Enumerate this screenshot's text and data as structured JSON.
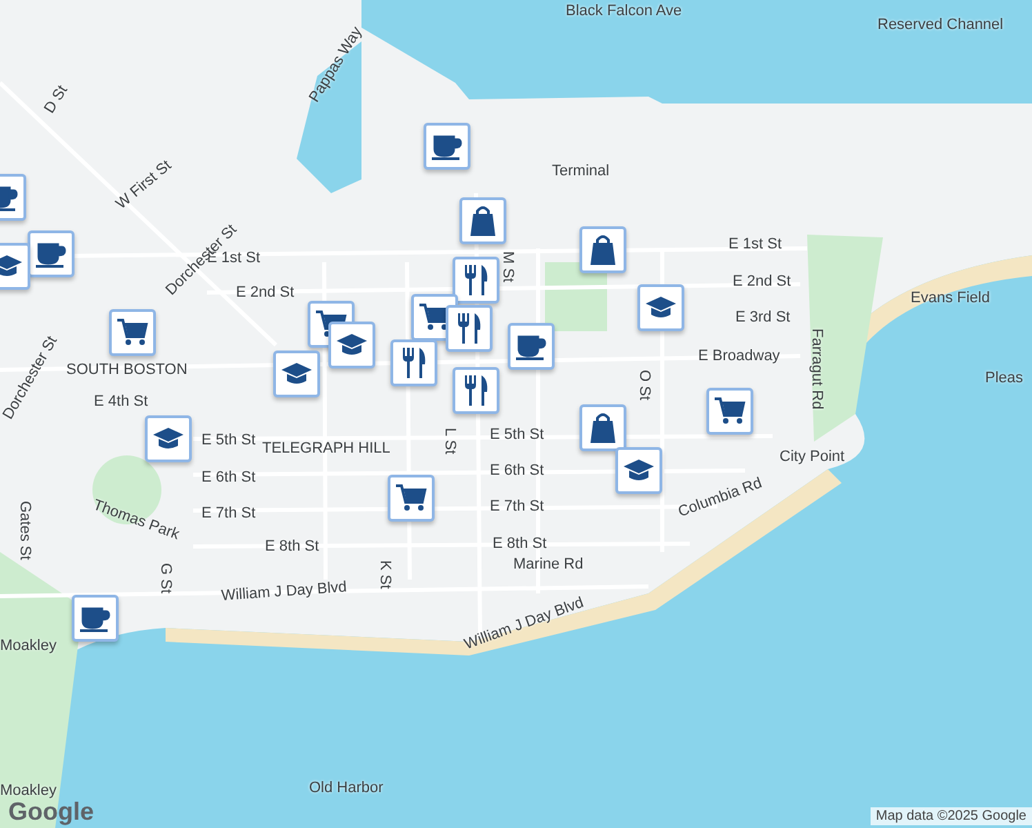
{
  "map": {
    "labels": [
      {
        "text": "Black Falcon Ave"
      },
      {
        "text": "Reserved Channel"
      },
      {
        "text": "Pappas Way"
      },
      {
        "text": "D St"
      },
      {
        "text": "W First St"
      },
      {
        "text": "E 1st St"
      },
      {
        "text": "E 1st St"
      },
      {
        "text": "E 2nd St"
      },
      {
        "text": "E 2nd St"
      },
      {
        "text": "E 3rd St"
      },
      {
        "text": "Dorchester St"
      },
      {
        "text": "SOUTH BOSTON"
      },
      {
        "text": "E Broadway"
      },
      {
        "text": "E 4th St"
      },
      {
        "text": "E 5th St"
      },
      {
        "text": "TELEGRAPH HILL"
      },
      {
        "text": "E 5th St"
      },
      {
        "text": "City Point"
      },
      {
        "text": "E 6th St"
      },
      {
        "text": "E 6th St"
      },
      {
        "text": "E 7th St"
      },
      {
        "text": "E 7th St"
      },
      {
        "text": "Thomas Park"
      },
      {
        "text": "Gates St"
      },
      {
        "text": "E 8th St"
      },
      {
        "text": "E 8th St"
      },
      {
        "text": "Marine Rd"
      },
      {
        "text": "Columbia Rd"
      },
      {
        "text": "William J Day Blvd"
      },
      {
        "text": "William J Day Blvd"
      },
      {
        "text": "Farragut Rd"
      },
      {
        "text": "Evans Field"
      },
      {
        "text": "Old Harbor"
      },
      {
        "text": "Moakley"
      },
      {
        "text": "Moakley"
      },
      {
        "text": "Pleas"
      },
      {
        "text": "L St"
      },
      {
        "text": "K St"
      },
      {
        "text": "G St"
      },
      {
        "text": "M St"
      },
      {
        "text": "O St"
      },
      {
        "text": "Terminal"
      },
      {
        "text": "Dorchester St"
      }
    ],
    "pins": [
      {
        "kind": "cafe"
      },
      {
        "kind": "cafe"
      },
      {
        "kind": "school"
      },
      {
        "kind": "cafe"
      },
      {
        "kind": "bag"
      },
      {
        "kind": "bag"
      },
      {
        "kind": "restaurant"
      },
      {
        "kind": "school"
      },
      {
        "kind": "cart"
      },
      {
        "kind": "cart"
      },
      {
        "kind": "restaurant"
      },
      {
        "kind": "cart"
      },
      {
        "kind": "school"
      },
      {
        "kind": "school"
      },
      {
        "kind": "restaurant"
      },
      {
        "kind": "cafe"
      },
      {
        "kind": "restaurant"
      },
      {
        "kind": "cart"
      },
      {
        "kind": "bag"
      },
      {
        "kind": "school"
      },
      {
        "kind": "school"
      },
      {
        "kind": "cart"
      },
      {
        "kind": "cafe"
      }
    ],
    "attribution": "Map data ©2025 Google",
    "logo": "Google"
  }
}
